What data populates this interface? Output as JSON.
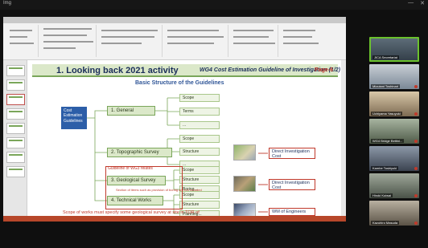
{
  "window": {
    "title": "Img",
    "controls": [
      "—",
      "✕"
    ]
  },
  "slide": {
    "title": "1. Looking back 2021 activity",
    "subtitle": "WG4 Cost Estimation Guideline of Investigation (1/2)",
    "page": "Page-6",
    "section_title": "Basic Structure of the Guidelines",
    "root_box": "Cost Estimation Guidelines",
    "nodes": [
      "1. General",
      "2. Topographic Survey",
      "3. Geological Survey",
      "4. Technical Works"
    ],
    "leaves": {
      "general": [
        "Scope",
        "Terms",
        "..."
      ],
      "topographic": [
        "Scope",
        "Structure",
        "..."
      ],
      "geological": [
        "Scope",
        "Structure",
        "Boring..."
      ],
      "technical": [
        "Scope",
        "Structure",
        "Planning..."
      ]
    },
    "wg_label": "Guideline of WG3 relates",
    "wg_note": "Section of items such as provision of boring are not included",
    "annotations": [
      "Direct Investigation Cost",
      "Direct Investigation Cost",
      "WM of Engineers"
    ],
    "bottom_note": "Scope of works must specify some geological survey at site in TOR of contract document"
  },
  "participants": [
    {
      "name": "JICA Secretariat"
    },
    {
      "name": "Mizutani Toshinari"
    },
    {
      "name": "Uchiyama Yasuyuki"
    },
    {
      "name": "WG4 Bridge Bettini..."
    },
    {
      "name": "Kambe Toshiyuki"
    },
    {
      "name": "Hiroki Koiwai"
    },
    {
      "name": "Kazuhiro Masuda"
    }
  ],
  "colors": {
    "title_bar": "#dbe8c9",
    "accent_green": "#7aa65a",
    "blue_box": "#2c5ea8",
    "red": "#c0392b",
    "active_speaker": "#6bc22d"
  }
}
